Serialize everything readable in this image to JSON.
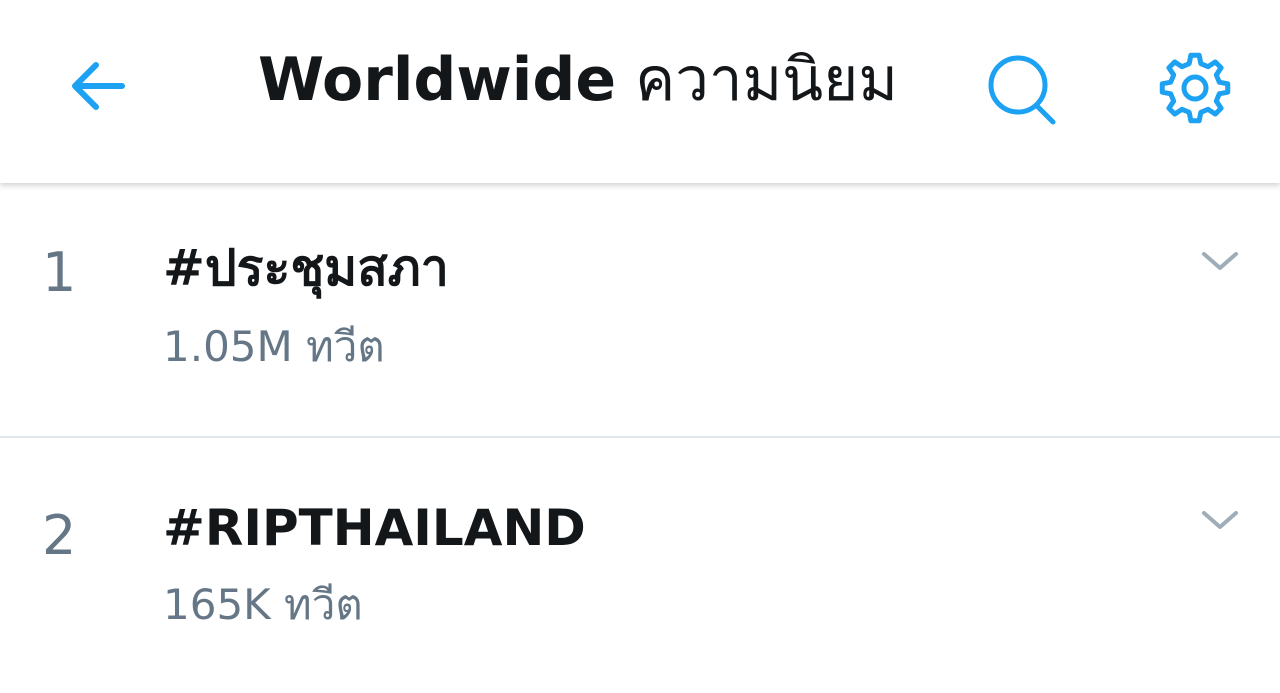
{
  "header": {
    "title_en": "Worldwide",
    "title_th": "ความนิยม",
    "back_icon": "arrow-left-icon",
    "search_icon": "search-icon",
    "settings_icon": "gear-icon"
  },
  "colors": {
    "accent": "#1da1f2",
    "text_primary": "#14171a",
    "text_secondary": "#657786",
    "divider": "#e1e8ed"
  },
  "trends": [
    {
      "rank": "1",
      "name": "#ประชุมสภา",
      "count": "1.05M ทวีต"
    },
    {
      "rank": "2",
      "name": "#RIPTHAILAND",
      "count": "165K ทวีต"
    }
  ]
}
